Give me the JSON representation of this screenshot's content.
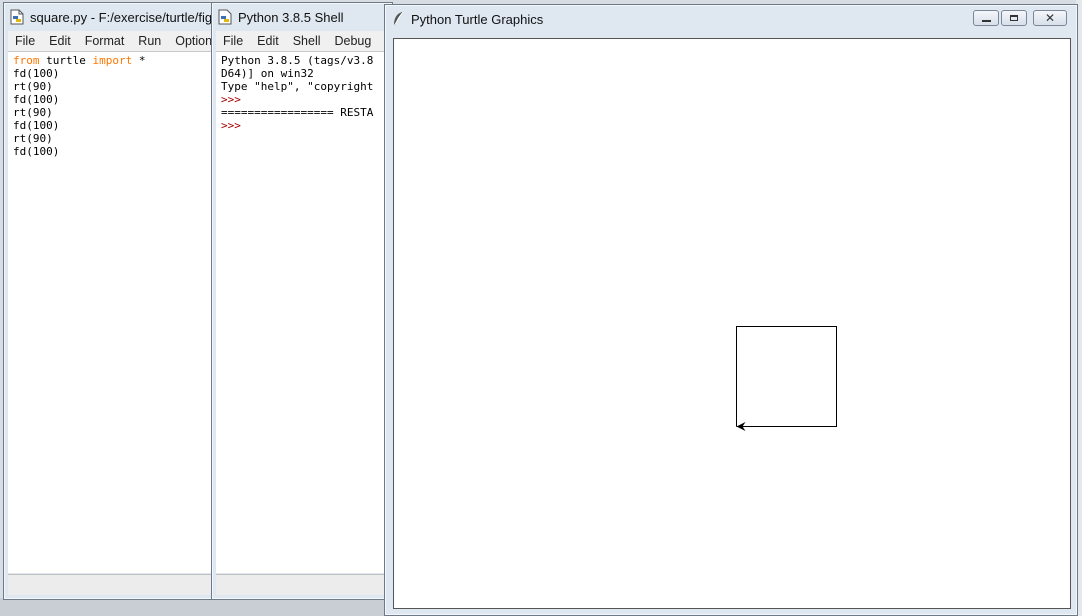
{
  "editor_window": {
    "title": "square.py - F:/exercise/turtle/fig",
    "menu": [
      "File",
      "Edit",
      "Format",
      "Run",
      "Options"
    ],
    "code": [
      [
        {
          "t": "from",
          "kw": true
        },
        {
          "t": " turtle "
        },
        {
          "t": "import",
          "kw": true
        },
        {
          "t": " *"
        }
      ],
      [
        {
          "t": "fd(100)"
        }
      ],
      [
        {
          "t": "rt(90)"
        }
      ],
      [
        {
          "t": "fd(100)"
        }
      ],
      [
        {
          "t": "rt(90)"
        }
      ],
      [
        {
          "t": "fd(100)"
        }
      ],
      [
        {
          "t": "rt(90)"
        }
      ],
      [
        {
          "t": "fd(100)"
        }
      ]
    ]
  },
  "shell_window": {
    "title": "Python 3.8.5 Shell",
    "menu": [
      "File",
      "Edit",
      "Shell",
      "Debug"
    ],
    "lines": [
      {
        "t": "Python 3.8.5 (tags/v3.8"
      },
      {
        "t": "D64)] on win32"
      },
      {
        "t": "Type \"help\", \"copyright"
      },
      {
        "t": ">>>",
        "prompt": true
      },
      {
        "t": "================= RESTA"
      },
      {
        "t": ">>>",
        "prompt": true
      }
    ]
  },
  "turtle_window": {
    "title": "Python Turtle Graphics",
    "controls": {
      "minimize": "minimize-icon",
      "maximize": "maximize-icon",
      "close": "close-icon"
    }
  },
  "turtle_drawing": {
    "commands": [
      "fd(100)",
      "rt(90)",
      "fd(100)",
      "rt(90)",
      "fd(100)",
      "rt(90)",
      "fd(100)"
    ],
    "side": 100,
    "heading": "up",
    "stroke": "#000000"
  }
}
